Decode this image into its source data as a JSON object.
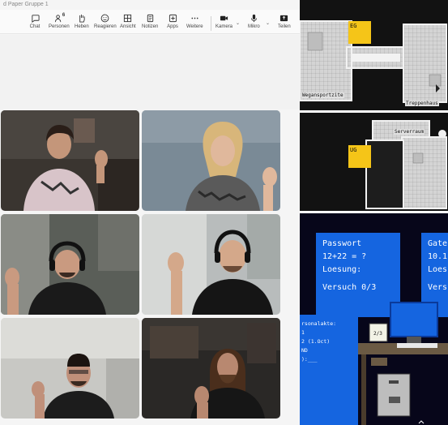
{
  "window": {
    "title": "d Paper Gruppe 1"
  },
  "toolbar": {
    "items": [
      {
        "label": "Chat",
        "icon": "chat-icon"
      },
      {
        "label": "Personen",
        "icon": "people-icon",
        "count": "6"
      },
      {
        "label": "Heben",
        "icon": "raise-hand-icon"
      },
      {
        "label": "Reagieren",
        "icon": "react-icon"
      },
      {
        "label": "Ansicht",
        "icon": "view-icon"
      },
      {
        "label": "Notizen",
        "icon": "notes-icon"
      },
      {
        "label": "Apps",
        "icon": "apps-icon"
      },
      {
        "label": "Weitere",
        "icon": "more-icon"
      },
      {
        "label": "Kamera",
        "icon": "camera-icon"
      },
      {
        "label": "Mikro",
        "icon": "mic-icon"
      },
      {
        "label": "Teilen",
        "icon": "share-icon"
      }
    ]
  },
  "participants": [
    {
      "id": "p1",
      "shirt": "#d8c4c9",
      "bg": "#3a3530"
    },
    {
      "id": "p2",
      "shirt": "#5a5a5a",
      "bg": "#7a8a96"
    },
    {
      "id": "p3",
      "shirt": "#1a1a1a",
      "bg": "#5a5e58"
    },
    {
      "id": "p4",
      "shirt": "#151515",
      "bg": "#b8bcbc"
    },
    {
      "id": "p5",
      "shirt": "#1c1c1c",
      "bg": "#c8c8c4"
    },
    {
      "id": "p6",
      "shirt": "#161616",
      "bg": "#2a2826"
    }
  ],
  "game": {
    "map_top": {
      "floor_tag": "EG",
      "room_labels": [
        "Wegansportzite",
        "Treppenhaus"
      ]
    },
    "map_bottom": {
      "floor_tag": "UG",
      "room_labels": [
        "Serverraum"
      ]
    },
    "panel_left": {
      "title": "Passwort",
      "question": "12+22 = ?",
      "answer_label": "Loesung:",
      "attempts": "Versuch 0/3"
    },
    "panel_right": {
      "title": "Gate",
      "question": "10.1",
      "answer_label": "Loes",
      "attempts": "Vers"
    },
    "console": {
      "lines": [
        "rsonalakte:",
        "  1",
        "  2 (1.Oct)",
        "ND",
        "):___"
      ]
    },
    "note_text": "2/3"
  }
}
